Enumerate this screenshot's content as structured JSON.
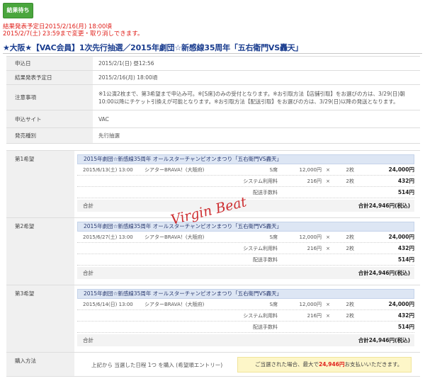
{
  "status_button": "結果待ち",
  "notice": {
    "line1": "結果発表予定日2015/2/16(月) 18:00頃",
    "line2": "2015/2/7(土) 23:59まで変更・取り消しできます。"
  },
  "main_title": "★大阪★【VAC会員】1次先行抽選／2015年劇団☆新感線35周年「五右衛門VS轟天」",
  "info": [
    {
      "label": "申込日",
      "value": "2015/2/1(日) 昼12:56"
    },
    {
      "label": "結果発表予定日",
      "value": "2015/2/16(月) 18:00頃"
    },
    {
      "label": "注意事項",
      "value": "※1公演2枚まで、第3希望まで申込み可。※[S席]のみの受付となります。※お引取方法【店舗引取】をお選びの方は、3/29(日)朝10:00以降にチケット引換えが可能となります。※お引取方法【配送引取】をお選びの方は、3/29(日)以降の発送となります。"
    },
    {
      "label": "申込サイト",
      "value": "VAC"
    },
    {
      "label": "発売種別",
      "value": "先行抽選"
    }
  ],
  "watermark": "Virgin Beat",
  "wishes": [
    {
      "label": "第1希望",
      "title": "2015年劇団☆新感線35周年 オールスターチャンピオンまつり「五右衛門VS轟天」",
      "date": "2015/6/13(土) 13:00",
      "venue": "シアターBRAVA！(大阪府)",
      "lines": [
        {
          "item": "S席",
          "price": "12,000円",
          "x": "×",
          "qty": "2枚",
          "total": "24,000円"
        },
        {
          "item": "システム利用料",
          "price": "216円",
          "x": "×",
          "qty": "2枚",
          "total": "432円"
        },
        {
          "item": "配送手数料",
          "price": "",
          "x": "",
          "qty": "",
          "total": "514円"
        }
      ],
      "sum_label": "合計",
      "sum_value": "合計24,946円(税込)"
    },
    {
      "label": "第2希望",
      "title": "2015年劇団☆新感線35周年 オールスターチャンピオンまつり「五右衛門VS轟天」",
      "date": "2015/6/27(土) 13:00",
      "venue": "シアターBRAVA！(大阪府)",
      "lines": [
        {
          "item": "S席",
          "price": "12,000円",
          "x": "×",
          "qty": "2枚",
          "total": "24,000円"
        },
        {
          "item": "システム利用料",
          "price": "216円",
          "x": "×",
          "qty": "2枚",
          "total": "432円"
        },
        {
          "item": "配送手数料",
          "price": "",
          "x": "",
          "qty": "",
          "total": "514円"
        }
      ],
      "sum_label": "合計",
      "sum_value": "合計24,946円(税込)"
    },
    {
      "label": "第3希望",
      "title": "2015年劇団☆新感線35周年 オールスターチャンピオンまつり「五右衛門VS轟天」",
      "date": "2015/6/14(日) 13:00",
      "venue": "シアターBRAVA！(大阪府)",
      "lines": [
        {
          "item": "S席",
          "price": "12,000円",
          "x": "×",
          "qty": "2枚",
          "total": "24,000円"
        },
        {
          "item": "システム利用料",
          "price": "216円",
          "x": "×",
          "qty": "2枚",
          "total": "432円"
        },
        {
          "item": "配送手数料",
          "price": "",
          "x": "",
          "qty": "",
          "total": "514円"
        }
      ],
      "sum_label": "合計",
      "sum_value": "合計24,946円(税込)"
    }
  ],
  "purchase": {
    "label": "購入方法",
    "method": "上記から 当選した日程 1つ を購入 (希望順エントリー)",
    "note_prefix": "ご当選された場合、最大で",
    "note_amount": "24,946円",
    "note_suffix": "お支払いいただきます。"
  }
}
